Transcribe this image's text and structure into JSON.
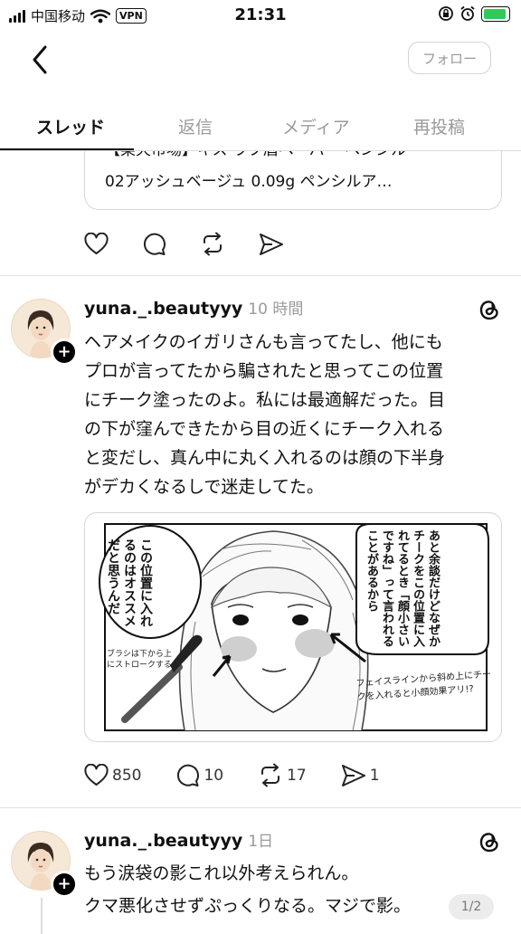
{
  "status_bar": {
    "carrier": "中国移动",
    "vpn": "VPN",
    "time": "21:31"
  },
  "header": {
    "follow_label": "フォロー"
  },
  "tabs": [
    {
      "label": "スレッド",
      "active": true
    },
    {
      "label": "返信",
      "active": false
    },
    {
      "label": "メディア",
      "active": false
    },
    {
      "label": "再投稿",
      "active": false
    }
  ],
  "quoted_card": {
    "line1": "【楽天市場】キス ラブ眉ペーパー ペンシル",
    "line2": "02アッシュベージュ 0.09g ペンシルア…"
  },
  "posts": [
    {
      "username": "yuna._.beautyyy",
      "time": "10 時間",
      "text": "ヘアメイクのイガリさんも言ってたし、他にも\nプロが言ってたから騙されたと思ってこの位置\nにチーク塗ったのよ。私には最適解だった。目\nの下が窪んできたから目の近くにチーク入れる\nと変だし、真ん中に丸く入れるのは顔の下半身\nがデカくなるしで迷走してた。",
      "image": {
        "balloon_left": "この位置に入れるのはオススメだと思うんだ",
        "balloon_right": "あと余談だけどなぜかチークをこの位置に入れてるとき「顔小さいですね」って言われることがあるから",
        "note_brush": "ブラシは下から上にストロークする",
        "note_face": "フェイスラインから斜め上にチークを入れると小顔効果アリ!?"
      },
      "likes": "850",
      "replies": "10",
      "reposts": "17",
      "shares": "1"
    },
    {
      "username": "yuna._.beautyyy",
      "time": "1日",
      "line1": "もう涙袋の影これ以外考えられん。",
      "line2": "クマ悪化させずぷっくりなる。マジで影。",
      "page": "1/2"
    }
  ],
  "icons": [
    "back-chevron-icon",
    "heart-icon",
    "comment-icon",
    "repost-icon",
    "share-icon",
    "threads-logo-icon",
    "plus-icon"
  ],
  "colors": {
    "battery": "#34c759",
    "muted": "#9a9a9a",
    "border": "#d6d6d6"
  }
}
